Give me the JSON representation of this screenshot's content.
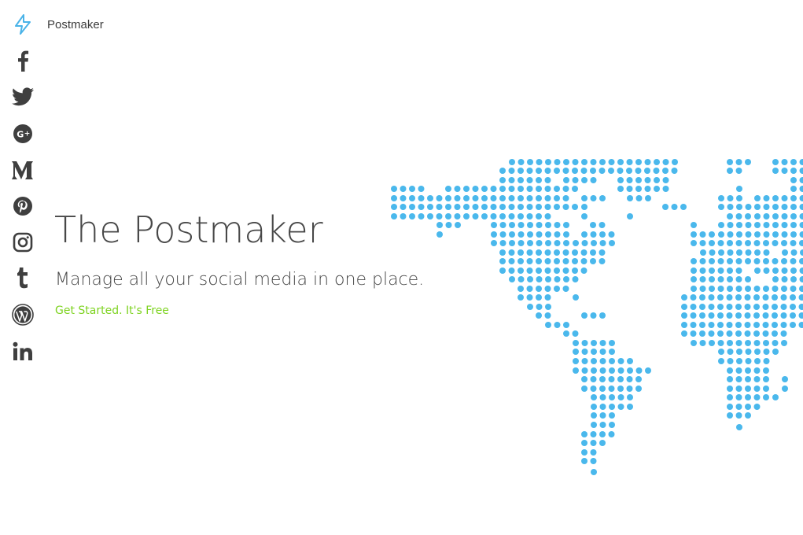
{
  "brand": {
    "name": "Postmaker",
    "logo_icon": "lightning-bolt-icon"
  },
  "social_icons": [
    {
      "name": "facebook-icon"
    },
    {
      "name": "twitter-icon"
    },
    {
      "name": "google-plus-icon"
    },
    {
      "name": "medium-icon"
    },
    {
      "name": "pinterest-icon"
    },
    {
      "name": "instagram-icon"
    },
    {
      "name": "tumblr-icon"
    },
    {
      "name": "wordpress-icon"
    },
    {
      "name": "linkedin-icon"
    }
  ],
  "hero": {
    "title": "The Postmaker",
    "subtitle": "Manage all your social media in one place.",
    "cta": "Get Started. It's Free"
  },
  "colors": {
    "accent": "#4ab3e8",
    "map_dot": "#4ab8ec",
    "icon": "#444444",
    "cta": "#7ed321",
    "text": "#484848"
  }
}
